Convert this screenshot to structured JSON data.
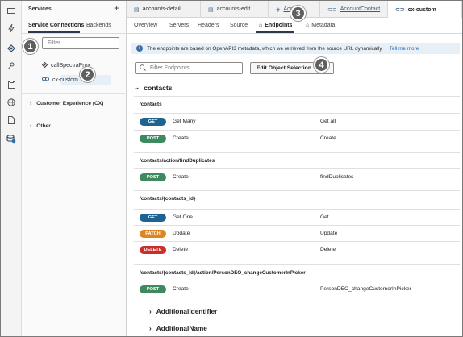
{
  "activity_bar": {
    "icons": [
      "monitor-icon",
      "lightning-icon",
      "services-icon",
      "pin-icon",
      "clipboard-icon",
      "globe-icon",
      "document-icon",
      "database-icon"
    ]
  },
  "services_panel": {
    "title": "Services",
    "add_label": "+",
    "tabs": [
      "Service Connections",
      "Backends"
    ],
    "filter_placeholder": "Filter",
    "tree": [
      {
        "label": "callSpectraProx"
      },
      {
        "label": "cx-custom"
      }
    ],
    "groups": [
      {
        "label": "Customer Experience (CX)"
      },
      {
        "label": "Other"
      }
    ]
  },
  "badges": [
    "1",
    "2",
    "3",
    "4"
  ],
  "editor_tabs": [
    {
      "label": "accounts-detail"
    },
    {
      "label": "accounts-edit"
    },
    {
      "label": "Acc"
    },
    {
      "label": "AccountContact"
    },
    {
      "label": "cx-custom"
    }
  ],
  "sub_tabs": [
    "Overview",
    "Servers",
    "Headers",
    "Source",
    "Endpoints",
    "Metadata"
  ],
  "banner": {
    "text": "The endpoints are based on OpenAPI3 metadata, which we retrieved from the source URL dynamically.",
    "link": "Tell me more"
  },
  "filter_endpoints_placeholder": "Filter Endpoints",
  "edit_button": "Edit Object Selection",
  "section": {
    "label": "contacts"
  },
  "method_colors": {
    "GET": "#1f6390",
    "POST": "#3d8a5e",
    "PATCH": "#e0841f",
    "DELETE": "#c9302c"
  },
  "groups": [
    {
      "path": "/contacts",
      "endpoints": [
        {
          "method": "GET",
          "name": "Get Many",
          "desc": "Get all"
        },
        {
          "method": "POST",
          "name": "Create",
          "desc": "Create"
        }
      ]
    },
    {
      "path": "/contacts/action/findDuplicates",
      "endpoints": [
        {
          "method": "POST",
          "name": "Create",
          "desc": "findDuplicates"
        }
      ]
    },
    {
      "path": "/contacts/{contacts_Id}",
      "endpoints": [
        {
          "method": "GET",
          "name": "Get One",
          "desc": "Get"
        },
        {
          "method": "PATCH",
          "name": "Update",
          "desc": "Update"
        },
        {
          "method": "DELETE",
          "name": "Delete",
          "desc": "Delete"
        }
      ]
    },
    {
      "path": "/contacts/{contacts_Id}/action/PersonDEO_changeCustomerInPicker",
      "endpoints": [
        {
          "method": "POST",
          "name": "Create",
          "desc": "PersonDEO_changeCustomerInPicker"
        }
      ]
    }
  ],
  "collapsed_sections": [
    {
      "label": "AdditionalIdentifier"
    },
    {
      "label": "AdditionalName"
    }
  ]
}
